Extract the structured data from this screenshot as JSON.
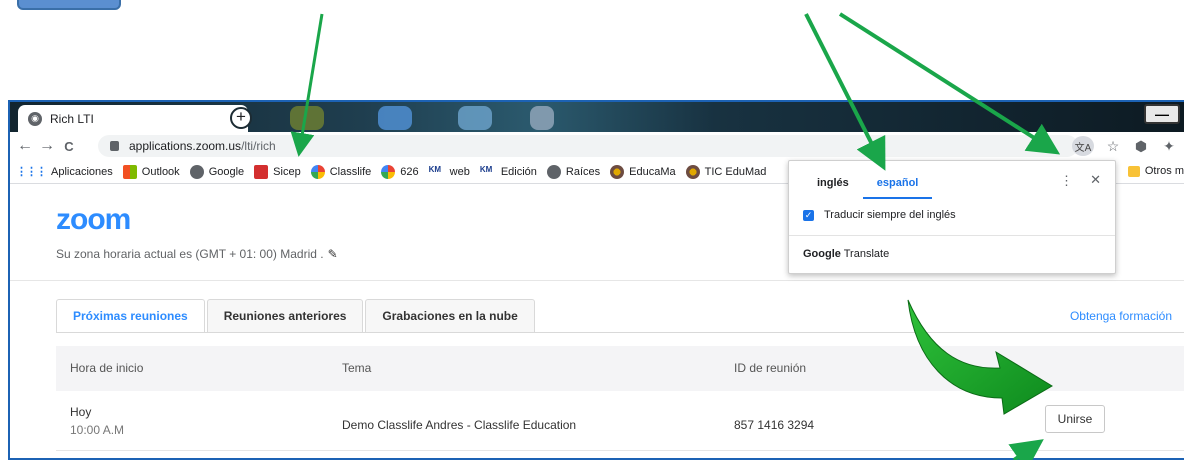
{
  "browser": {
    "tab_title": "Rich LTI",
    "tab_close": "×",
    "new_tab": "+",
    "url_host": "applications.zoom.us",
    "url_path": "/lti/rich",
    "back": "←",
    "forward": "→",
    "reload": "C",
    "window_minimize": "—"
  },
  "bookmarks": [
    {
      "label": "Aplicaciones",
      "icon": "apps-grid-icon",
      "color": "#1a73e8"
    },
    {
      "label": "Outlook",
      "icon": "microsoft-icon",
      "color": "#f25022"
    },
    {
      "label": "Google",
      "icon": "globe-icon",
      "color": "#5f6368"
    },
    {
      "label": "Sicep",
      "icon": "sicep-icon",
      "color": "#d32f2f"
    },
    {
      "label": "Classlife",
      "icon": "classlife-icon",
      "color": "#34a853"
    },
    {
      "label": "626",
      "icon": "classlife-icon",
      "color": "#34a853"
    },
    {
      "label": "web",
      "icon": "km-icon",
      "color": "#1a3c8c"
    },
    {
      "label": "Edición",
      "icon": "km-icon",
      "color": "#1a3c8c"
    },
    {
      "label": "Raíces",
      "icon": "globe-icon",
      "color": "#5f6368"
    },
    {
      "label": "EducaMa",
      "icon": "educamadrid-icon",
      "color": "#e0a800"
    },
    {
      "label": "TIC EduMad",
      "icon": "educamadrid-icon",
      "color": "#e0a800"
    }
  ],
  "bookmarks_other": "Otros m",
  "page": {
    "logo": "zoom",
    "timezone": "Su zona horaria actual es (GMT + 01: 00) Madrid .",
    "tabs": [
      "Próximas reuniones",
      "Reuniones anteriores",
      "Grabaciones en la nube"
    ],
    "training_link": "Obtenga formación",
    "table": {
      "headers": [
        "Hora de inicio",
        "Tema",
        "ID de reunión"
      ],
      "rows": [
        {
          "day": "Hoy",
          "time": "10:00 A.M",
          "topic": "Demo Classlife Andres - Classlife Education",
          "meeting_id": "857 1416 3294",
          "action": "Unirse"
        }
      ]
    }
  },
  "translate_popup": {
    "tabs": [
      "inglés",
      "español"
    ],
    "active_tab": "español",
    "menu": "⋮",
    "close": "✕",
    "checkbox_label": "Traducir siempre del inglés",
    "checkbox_checked": true,
    "brand_google": "Google",
    "brand_translate": " Translate"
  },
  "colors": {
    "zoom_blue": "#2D8CFF",
    "arrow_green": "#1aa64a",
    "chrome_blue": "#1a73e8"
  }
}
